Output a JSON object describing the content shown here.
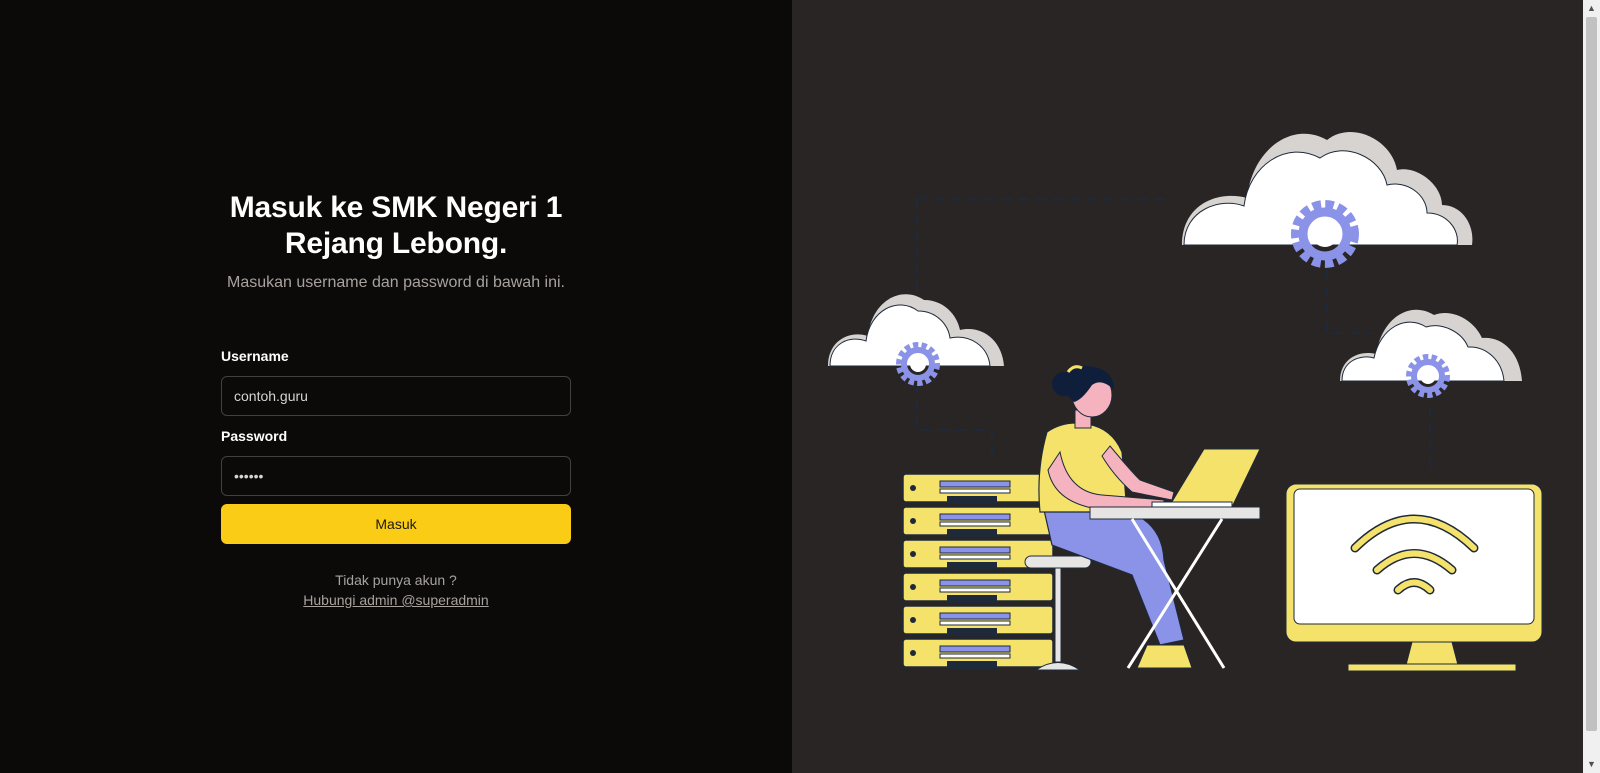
{
  "login": {
    "title": "Masuk ke SMK Negeri 1 Rejang Lebong.",
    "subtitle": "Masukan username dan password di bawah ini.",
    "username_label": "Username",
    "username_value": "contoh.guru",
    "password_label": "Password",
    "password_value": "••••••",
    "submit_label": "Masuk",
    "no_account_text": "Tidak punya akun ?",
    "contact_link": "Hubungi admin @superadmin"
  },
  "colors": {
    "left_bg": "#0c0a09",
    "right_bg": "#292524",
    "accent": "#facc15"
  },
  "illustration": {
    "name": "cloud-computing-illustration",
    "icons": [
      "cloud-icon",
      "gear-icon",
      "server-rack-icon",
      "person-laptop-icon",
      "monitor-wifi-icon"
    ]
  }
}
